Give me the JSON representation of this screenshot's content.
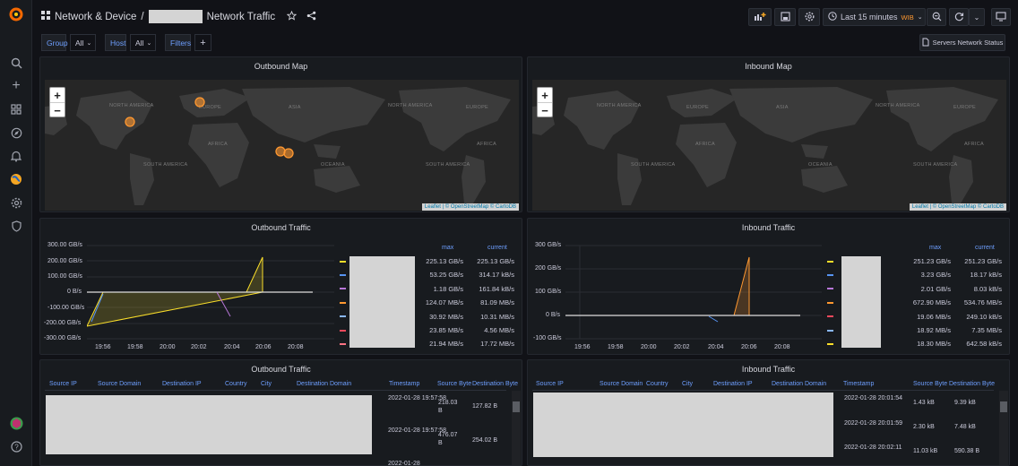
{
  "app": {
    "breadcrumb_folder": "Network & Device",
    "breadcrumb_sep": "/",
    "dashboard_title": "Network Traffic",
    "time_picker": "Last 15 minutes",
    "time_zone": "WIB"
  },
  "variables": {
    "group_label": "Group",
    "group_value": "All",
    "host_label": "Host",
    "host_value": "All",
    "filters_label": "Filters",
    "add_label": "+"
  },
  "toolbar": {
    "status_link": "Servers Network Status"
  },
  "maps": {
    "outbound_title": "Outbound Map",
    "inbound_title": "Inbound Map",
    "attribution": "Leaflet | © OpenStreetMap © CartoDB",
    "zoom_in": "+",
    "zoom_out": "−",
    "labels": [
      "NORTH AMERICA",
      "EUROPE",
      "ASIA",
      "AFRICA",
      "SOUTH AMERICA",
      "OCEANIA"
    ]
  },
  "outbound_traffic": {
    "title": "Outbound Traffic",
    "y_ticks": [
      "300.00 GB/s",
      "200.00 GB/s",
      "100.00 GB/s",
      "0 B/s",
      "-100.00 GB/s",
      "-200.00 GB/s",
      "-300.00 GB/s"
    ],
    "x_ticks": [
      "19:56",
      "19:58",
      "20:00",
      "20:02",
      "20:04",
      "20:06",
      "20:08"
    ],
    "legend_max": "max",
    "legend_current": "current",
    "legend_rows": [
      {
        "color": "#fade2a",
        "max": "225.13 GB/s",
        "current": "225.13 GB/s"
      },
      {
        "color": "#5794f2",
        "max": "53.25 GB/s",
        "current": "314.17 kB/s"
      },
      {
        "color": "#b877d9",
        "max": "1.18 GB/s",
        "current": "161.84 kB/s"
      },
      {
        "color": "#ff9830",
        "max": "124.07 MB/s",
        "current": "81.09 MB/s"
      },
      {
        "color": "#8ab8ff",
        "max": "30.92 MB/s",
        "current": "10.31 MB/s"
      },
      {
        "color": "#f2495c",
        "max": "23.85 MB/s",
        "current": "4.56 MB/s"
      },
      {
        "color": "#ff7383",
        "max": "21.94 MB/s",
        "current": "17.72 MB/s"
      }
    ]
  },
  "inbound_traffic": {
    "title": "Inbound Traffic",
    "y_ticks": [
      "300 GB/s",
      "200 GB/s",
      "100 GB/s",
      "0 B/s",
      "-100 GB/s"
    ],
    "x_ticks": [
      "19:56",
      "19:58",
      "20:00",
      "20:02",
      "20:04",
      "20:06",
      "20:08"
    ],
    "legend_max": "max",
    "legend_current": "current",
    "legend_rows": [
      {
        "color": "#fade2a",
        "max": "251.23 GB/s",
        "current": "251.23 GB/s"
      },
      {
        "color": "#5794f2",
        "max": "3.23 GB/s",
        "current": "18.17 kB/s"
      },
      {
        "color": "#b877d9",
        "max": "2.01 GB/s",
        "current": "8.03 kB/s"
      },
      {
        "color": "#ff9830",
        "max": "672.90 MB/s",
        "current": "534.76 MB/s"
      },
      {
        "color": "#f2495c",
        "max": "19.06 MB/s",
        "current": "249.10 kB/s"
      },
      {
        "color": "#8ab8ff",
        "max": "18.92 MB/s",
        "current": "7.35 MB/s"
      },
      {
        "color": "#fade2a",
        "max": "18.30 MB/s",
        "current": "642.58 kB/s"
      }
    ]
  },
  "outbound_table": {
    "title": "Outbound Traffic",
    "headers": [
      "Source IP",
      "Source Domain",
      "Destination IP",
      "Country",
      "City",
      "Destination Domain",
      "Timestamp",
      "Source Byte",
      "Destination Byte"
    ],
    "rows": [
      {
        "timestamp": "2022-01-28 19:57:58",
        "src_byte": "218.03 B",
        "dst_byte": "127.82 B"
      },
      {
        "timestamp": "2022-01-28 19:57:58",
        "src_byte": "476.07 B",
        "dst_byte": "254.02 B"
      },
      {
        "timestamp": "2022-01-28",
        "src_byte": "",
        "dst_byte": ""
      }
    ]
  },
  "inbound_table": {
    "title": "Inbound Traffic",
    "headers": [
      "Source IP",
      "Source Domain",
      "Country",
      "City",
      "Destination IP",
      "Destination Domain",
      "Timestamp",
      "Source Byte",
      "Destination Byte"
    ],
    "rows": [
      {
        "timestamp": "2022-01-28 20:01:54",
        "src_byte": "1.43 kB",
        "dst_byte": "9.39 kB"
      },
      {
        "timestamp": "2022-01-28 20:01:59",
        "src_byte": "2.30 kB",
        "dst_byte": "7.48 kB"
      },
      {
        "timestamp": "2022-01-28 20:02:11",
        "src_byte": "11.03 kB",
        "dst_byte": "590.38 B"
      }
    ]
  },
  "colors": {
    "accent": "#6e9fff",
    "bg": "#111217",
    "panel": "#181b1f",
    "marker": "#ff9830"
  }
}
